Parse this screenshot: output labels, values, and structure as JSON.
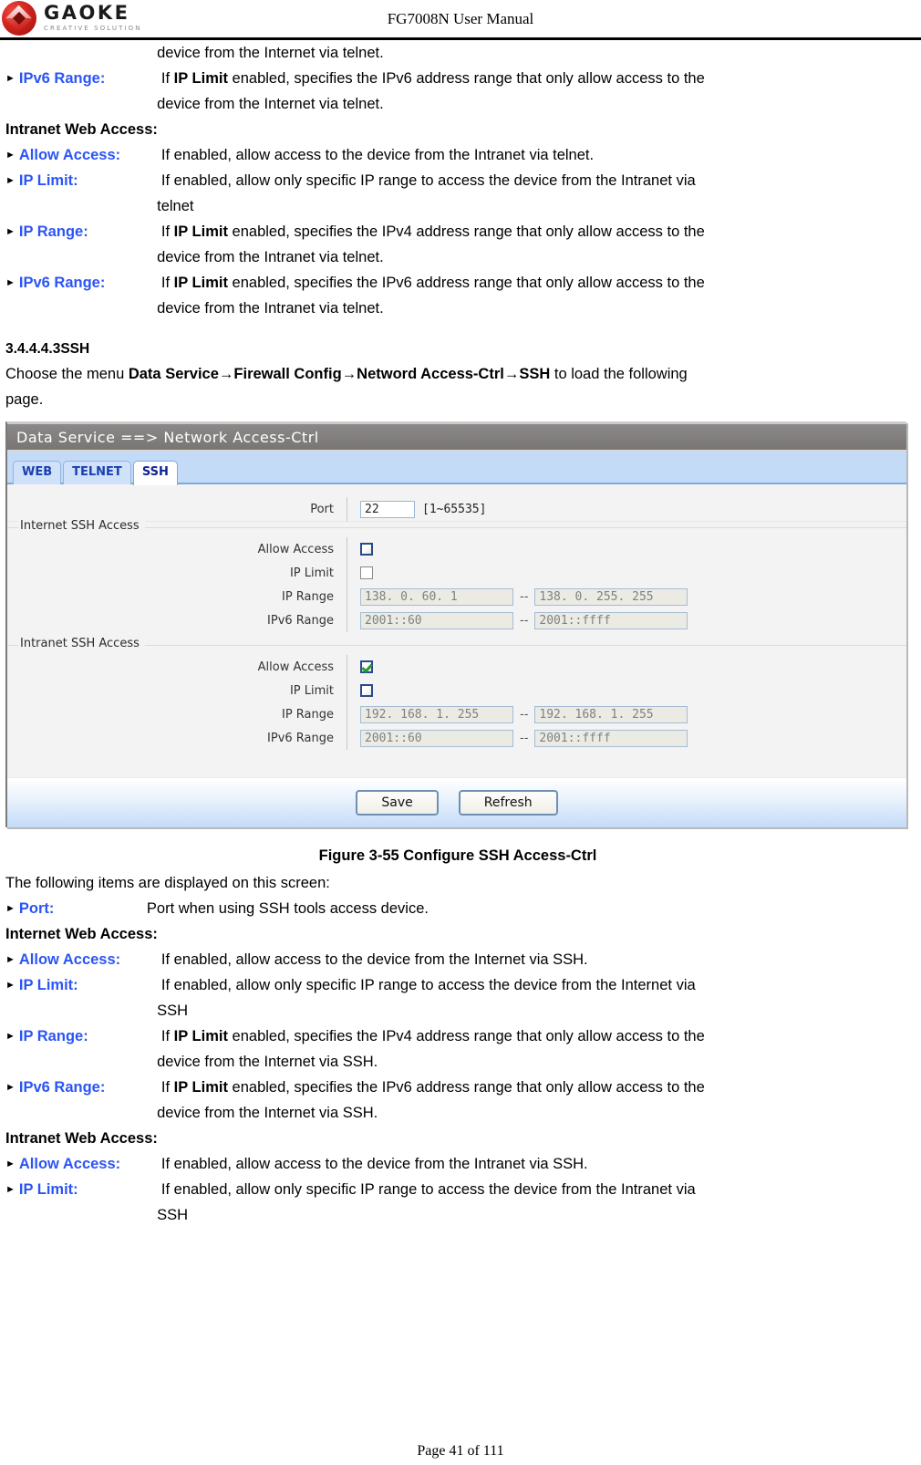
{
  "header": {
    "logo_word": "GAOKE",
    "logo_sub": "CREATIVE SOLUTION",
    "doc_title": "FG7008N User Manual"
  },
  "top_section": {
    "telnet_ipv6_cont": "device from the Internet via telnet.",
    "items_internet": [
      {
        "term": "IPv6 Range:",
        "desc_pre": "If ",
        "desc_bold": "IP Limit",
        "desc_post": " enabled, specifies the IPv6 address range that only allow access to the",
        "desc_line2": "device from the Internet via telnet."
      }
    ],
    "intranet_heading": "Intranet Web Access:",
    "items_intranet": [
      {
        "term": "Allow Access:",
        "desc_pre": "If enabled, allow access to the device from the Intranet via telnet.",
        "desc_bold": "",
        "desc_post": "",
        "desc_line2": ""
      },
      {
        "term": "IP Limit:",
        "desc_pre": "If enabled, allow only specific IP range to access the device from the Intranet via",
        "desc_bold": "",
        "desc_post": "",
        "desc_line2": "telnet"
      },
      {
        "term": "IP Range:",
        "desc_pre": "If ",
        "desc_bold": "IP Limit",
        "desc_post": " enabled, specifies the IPv4 address range that only allow access to the",
        "desc_line2": "device from the Intranet via telnet."
      },
      {
        "term": "IPv6 Range:",
        "desc_pre": "If ",
        "desc_bold": "IP Limit",
        "desc_post": " enabled, specifies the IPv6 address range that only allow access to the",
        "desc_line2": "device from the Intranet via telnet."
      }
    ]
  },
  "section": {
    "number": "3.4.4.4.3",
    "title": "SSH",
    "intro_pre": "Choose the menu ",
    "intro_path": "Data Service→Firewall Config→Netword Access-Ctrl→SSH",
    "intro_post": " to load the following",
    "intro_line2": "page."
  },
  "screenshot": {
    "titlebar": "Data Service ==> Network Access-Ctrl",
    "tabs": [
      {
        "label": "WEB",
        "active": false
      },
      {
        "label": "TELNET",
        "active": false
      },
      {
        "label": "SSH",
        "active": true
      }
    ],
    "port_row": {
      "label": "Port",
      "value": "22",
      "hint": "[1~65535]"
    },
    "internet_group": {
      "title": "Internet SSH Access",
      "allow_access_label": "Allow Access",
      "allow_access_checked": false,
      "ip_limit_label": "IP Limit",
      "ip_limit_checked": false,
      "ip_range_label": "IP Range",
      "ip_range_start": "138. 0. 60. 1",
      "ip_range_end": "138. 0. 255. 255",
      "ipv6_range_label": "IPv6 Range",
      "ipv6_range_start": "2001::60",
      "ipv6_range_end": "2001::ffff",
      "range_separator": "--"
    },
    "intranet_group": {
      "title": "Intranet SSH Access",
      "allow_access_label": "Allow Access",
      "allow_access_checked": true,
      "ip_limit_label": "IP Limit",
      "ip_limit_checked": false,
      "ip_range_label": "IP Range",
      "ip_range_start": "192. 168. 1. 255",
      "ip_range_end": "192. 168. 1. 255",
      "ipv6_range_label": "IPv6 Range",
      "ipv6_range_start": "2001::60",
      "ipv6_range_end": "2001::ffff",
      "range_separator": "--"
    },
    "buttons": {
      "save": "Save",
      "refresh": "Refresh"
    }
  },
  "figure_caption": "Figure 3-55  Configure SSH Access-Ctrl",
  "bottom_section": {
    "intro": "The following items are displayed on this screen:",
    "port_item": {
      "term": "Port:",
      "desc": "Port when using SSH tools access device."
    },
    "internet_heading": "Internet Web Access:",
    "items_internet": [
      {
        "term": "Allow Access:",
        "desc_pre": "If enabled, allow access to the device from the Internet via SSH.",
        "desc_bold": "",
        "desc_post": "",
        "desc_line2": ""
      },
      {
        "term": "IP Limit:",
        "desc_pre": "If enabled, allow only specific IP range to access the device from the Internet via",
        "desc_bold": "",
        "desc_post": "",
        "desc_line2": "SSH"
      },
      {
        "term": "IP Range:",
        "desc_pre": "If ",
        "desc_bold": "IP Limit",
        "desc_post": " enabled, specifies the IPv4 address range that only allow access to the",
        "desc_line2": "device from the Internet via SSH."
      },
      {
        "term": "IPv6 Range:",
        "desc_pre": "If ",
        "desc_bold": "IP Limit",
        "desc_post": " enabled, specifies the IPv6 address range that only allow access to the",
        "desc_line2": "device from the Internet via SSH."
      }
    ],
    "intranet_heading": "Intranet Web Access:",
    "items_intranet": [
      {
        "term": "Allow Access:",
        "desc_pre": "If enabled, allow access to the device from the Intranet via SSH.",
        "desc_bold": "",
        "desc_post": "",
        "desc_line2": ""
      },
      {
        "term": "IP Limit:",
        "desc_pre": "If enabled, allow only specific IP range to access the device from the Intranet via",
        "desc_bold": "",
        "desc_post": "",
        "desc_line2": "SSH"
      }
    ]
  },
  "footer": {
    "page_label": "Page 41 of 111"
  }
}
